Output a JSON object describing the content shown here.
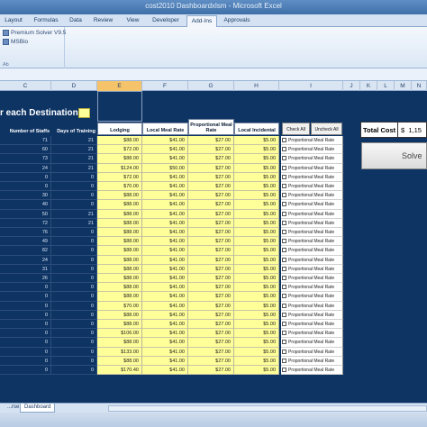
{
  "window": {
    "title": "cost2010 Dashboardxlsm - Microsoft Excel"
  },
  "ribbon_tabs": [
    "Layout",
    "Formulas",
    "Data",
    "Review",
    "View",
    "Developer",
    "Add-Ins",
    "Approvals"
  ],
  "ribbon_active_tab": "Add-Ins",
  "ribbon_group": {
    "lines": [
      "Premium Solver V9.5",
      "MSBio"
    ],
    "label": "Ab"
  },
  "columns": [
    "C",
    "D",
    "E",
    "F",
    "G",
    "H",
    "I",
    "J",
    "K",
    "L",
    "M",
    "N"
  ],
  "selected_column": "E",
  "heading": "r each Destination -",
  "table_headers": {
    "staffs": "Number of Staffs",
    "days": "Days of Training",
    "lodging": "Lodging",
    "local_meal": "Local Meal Rate",
    "prop_meal": "Proportional Meal Rate",
    "incidental": "Local Incidental"
  },
  "buttons": {
    "check_all": "Check All",
    "uncheck_all": "Uncheck All"
  },
  "checkbox_label": "Proportional Meal Rate",
  "rows": [
    {
      "staffs": "71",
      "days": "21",
      "lodging": "$88.00",
      "local": "$41.00",
      "prop": "$27.00",
      "inc": "$5.00"
    },
    {
      "staffs": "60",
      "days": "21",
      "lodging": "$72.00",
      "local": "$41.00",
      "prop": "$27.00",
      "inc": "$5.00"
    },
    {
      "staffs": "73",
      "days": "21",
      "lodging": "$88.00",
      "local": "$41.00",
      "prop": "$27.00",
      "inc": "$5.00"
    },
    {
      "staffs": "24",
      "days": "21",
      "lodging": "$124.00",
      "local": "$50.00",
      "prop": "$27.00",
      "inc": "$5.00"
    },
    {
      "staffs": "0",
      "days": "0",
      "lodging": "$72.00",
      "local": "$41.00",
      "prop": "$27.00",
      "inc": "$5.00"
    },
    {
      "staffs": "0",
      "days": "0",
      "lodging": "$70.00",
      "local": "$41.00",
      "prop": "$27.00",
      "inc": "$5.00"
    },
    {
      "staffs": "30",
      "days": "0",
      "lodging": "$88.00",
      "local": "$41.00",
      "prop": "$27.00",
      "inc": "$5.00"
    },
    {
      "staffs": "40",
      "days": "0",
      "lodging": "$88.00",
      "local": "$41.00",
      "prop": "$27.00",
      "inc": "$5.00"
    },
    {
      "staffs": "50",
      "days": "21",
      "lodging": "$88.00",
      "local": "$41.00",
      "prop": "$27.00",
      "inc": "$5.00"
    },
    {
      "staffs": "72",
      "days": "21",
      "lodging": "$88.00",
      "local": "$41.00",
      "prop": "$27.00",
      "inc": "$5.00"
    },
    {
      "staffs": "76",
      "days": "0",
      "lodging": "$88.00",
      "local": "$41.00",
      "prop": "$27.00",
      "inc": "$5.00"
    },
    {
      "staffs": "49",
      "days": "0",
      "lodging": "$88.00",
      "local": "$41.00",
      "prop": "$27.00",
      "inc": "$5.00"
    },
    {
      "staffs": "82",
      "days": "0",
      "lodging": "$88.00",
      "local": "$41.00",
      "prop": "$27.00",
      "inc": "$5.00"
    },
    {
      "staffs": "24",
      "days": "0",
      "lodging": "$88.00",
      "local": "$41.00",
      "prop": "$27.00",
      "inc": "$5.00"
    },
    {
      "staffs": "31",
      "days": "0",
      "lodging": "$88.00",
      "local": "$41.00",
      "prop": "$27.00",
      "inc": "$5.00"
    },
    {
      "staffs": "26",
      "days": "0",
      "lodging": "$88.00",
      "local": "$41.00",
      "prop": "$27.00",
      "inc": "$5.00"
    },
    {
      "staffs": "0",
      "days": "0",
      "lodging": "$88.00",
      "local": "$41.00",
      "prop": "$27.00",
      "inc": "$5.00"
    },
    {
      "staffs": "0",
      "days": "0",
      "lodging": "$88.00",
      "local": "$41.00",
      "prop": "$27.00",
      "inc": "$5.00"
    },
    {
      "staffs": "0",
      "days": "0",
      "lodging": "$70.00",
      "local": "$41.00",
      "prop": "$27.00",
      "inc": "$5.00"
    },
    {
      "staffs": "0",
      "days": "0",
      "lodging": "$88.00",
      "local": "$41.00",
      "prop": "$27.00",
      "inc": "$5.00"
    },
    {
      "staffs": "0",
      "days": "0",
      "lodging": "$88.00",
      "local": "$41.00",
      "prop": "$27.00",
      "inc": "$5.00"
    },
    {
      "staffs": "0",
      "days": "0",
      "lodging": "$106.00",
      "local": "$41.00",
      "prop": "$27.00",
      "inc": "$5.00"
    },
    {
      "staffs": "0",
      "days": "0",
      "lodging": "$88.00",
      "local": "$41.00",
      "prop": "$27.00",
      "inc": "$5.00"
    },
    {
      "staffs": "0",
      "days": "0",
      "lodging": "$133.00",
      "local": "$41.00",
      "prop": "$27.00",
      "inc": "$5.00"
    },
    {
      "staffs": "0",
      "days": "0",
      "lodging": "$88.00",
      "local": "$41.00",
      "prop": "$27.00",
      "inc": "$5.00"
    },
    {
      "staffs": "0",
      "days": "0",
      "lodging": "$170.40",
      "local": "$41.00",
      "prop": "$27.00",
      "inc": "$5.00"
    }
  ],
  "total": {
    "label": "Total Cost",
    "currency": "$",
    "value": "1,15"
  },
  "solve_button": "Solve",
  "sheet_tabs": [
    "...rse",
    "Dashboard"
  ],
  "active_sheet": "Dashboard"
}
